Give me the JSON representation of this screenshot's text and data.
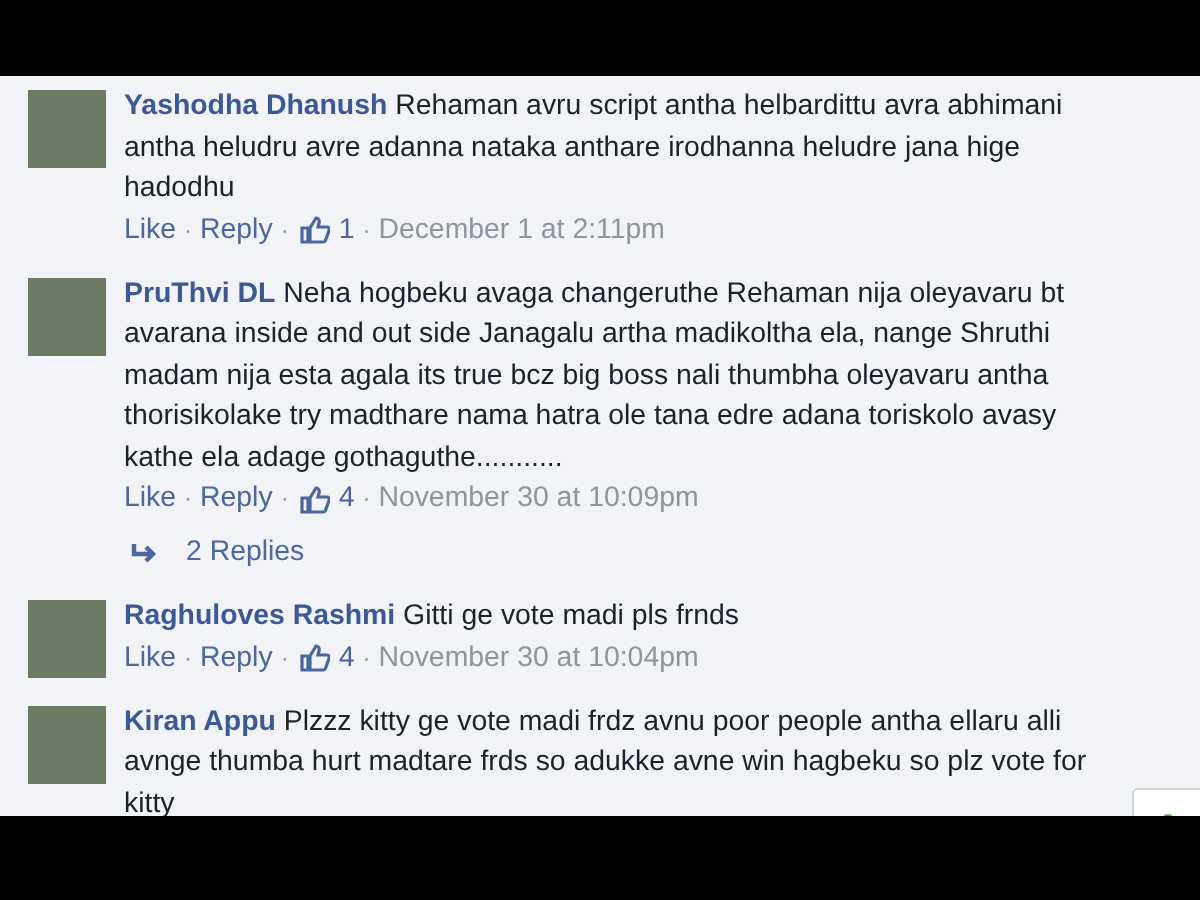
{
  "comments": [
    {
      "author": "Yashodha Dhanush",
      "text": "Rehaman avru script antha helbardittu avra abhimani antha heludru avre adanna nataka anthare irodhanna heludre jana hige hadodhu",
      "like": "Like",
      "reply": "Reply",
      "sep": "·",
      "likes": "1",
      "time": "December 1 at 2:11pm"
    },
    {
      "author": "PruThvi DL",
      "text": "Neha hogbeku avaga changeruthe Rehaman nija oleyavaru bt avarana inside and out side Janagalu artha madikoltha ela, nange Shruthi madam nija esta agala its true bcz big boss nali thumbha oleyavaru antha thorisikolake try madthare nama hatra ole tana edre adana toriskolo avasy kathe ela adage gothaguthe...........",
      "like": "Like",
      "reply": "Reply",
      "sep": "·",
      "likes": "4",
      "time": "November 30 at 10:09pm",
      "replies": "2 Replies"
    },
    {
      "author": "Raghuloves Rashmi",
      "text": "Gitti ge vote madi pls frnds",
      "like": "Like",
      "reply": "Reply",
      "sep": "·",
      "likes": "4",
      "time": "November 30 at 10:04pm"
    },
    {
      "author": "Kiran Appu",
      "text": "Plzzz kitty ge vote madi frdz avnu poor people antha ellaru alli avnge thumba hurt madtare frds so adukke avne win hagbeku so plz vote for kitty"
    }
  ]
}
